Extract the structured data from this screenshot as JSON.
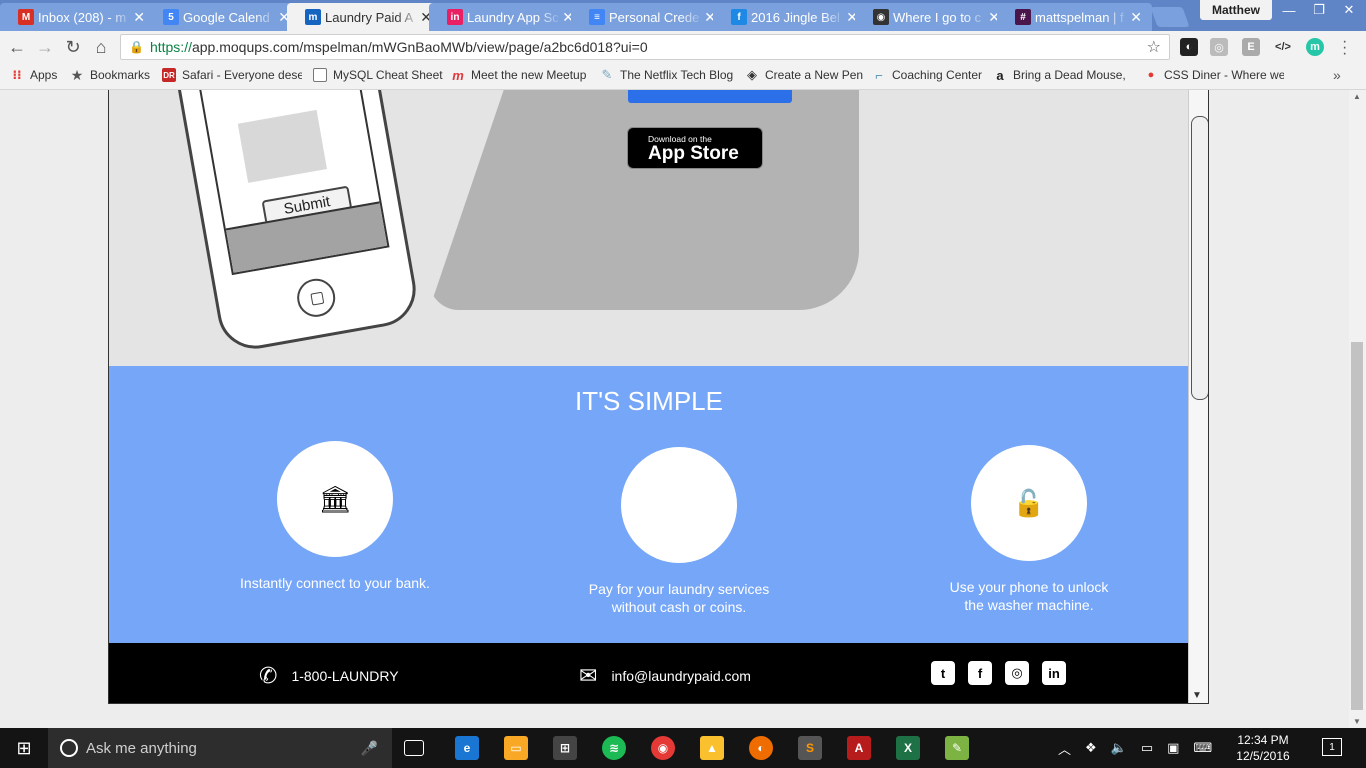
{
  "browser": {
    "tabs": [
      {
        "title": "Inbox (208) - m",
        "color": "#d93025",
        "glyph": "M"
      },
      {
        "title": "Google Calend",
        "color": "#4285f4",
        "glyph": "5"
      },
      {
        "title": "Laundry Paid A",
        "color": "#1565c0",
        "glyph": "m",
        "active": true
      },
      {
        "title": "Laundry App Sc",
        "color": "#e91e63",
        "glyph": "in"
      },
      {
        "title": "Personal Crede",
        "color": "#4285f4",
        "glyph": "≡"
      },
      {
        "title": "2016 Jingle Bel",
        "color": "#1e88e5",
        "glyph": "f"
      },
      {
        "title": "Where I go to c",
        "color": "#333333",
        "glyph": "◉"
      },
      {
        "title": "mattspelman | f",
        "color": "#4a154b",
        "glyph": "#"
      }
    ],
    "profile_name": "Matthew",
    "window_controls": {
      "minimize": "—",
      "restore": "❐",
      "close": "✕"
    },
    "url_scheme": "https://",
    "url_rest": "app.moqups.com/mspelman/mWGnBaoMWb/view/page/a2bc6d018?ui=0",
    "bookmarks": [
      {
        "label": "Apps",
        "icon": "apps-icon",
        "color": "#e53935",
        "glyph": "⋮⋮"
      },
      {
        "label": "Bookmarks",
        "icon": "star-icon",
        "color": "#555555",
        "glyph": "★"
      },
      {
        "label": "Safari - Everyone dese",
        "icon": "safari-icon",
        "color": "#c62828",
        "glyph": "DR"
      },
      {
        "label": "MySQL Cheat Sheet",
        "icon": "page-icon",
        "color": "#777777",
        "glyph": "▯"
      },
      {
        "label": "Meet the new Meetup",
        "icon": "meetup-icon",
        "color": "#e0393e",
        "glyph": "m"
      },
      {
        "label": "The Netflix Tech Blog",
        "icon": "pen-icon",
        "color": "#7aa6c2",
        "glyph": "✎"
      },
      {
        "label": "Create a New Pen",
        "icon": "codepen-icon",
        "color": "#333333",
        "glyph": "◈"
      },
      {
        "label": "Coaching Center",
        "icon": "coach-icon",
        "color": "#4a90b8",
        "glyph": "⌐"
      },
      {
        "label": "Bring a Dead Mouse,",
        "icon": "amazon-icon",
        "color": "#222222",
        "glyph": "a"
      },
      {
        "label": "CSS Diner - Where we",
        "icon": "diner-icon",
        "color": "#e53935",
        "glyph": "●"
      }
    ],
    "bookmarks_more": "»"
  },
  "page": {
    "phone_submit_label": "Submit",
    "appstore_small": "Download on the",
    "appstore_big": "App Store",
    "section_title": "IT'S SIMPLE",
    "features": [
      {
        "icon": "bank-icon",
        "glyph": "🏛",
        "text_line1": "Instantly connect to your bank.",
        "text_line2": ""
      },
      {
        "icon": "apple-icon",
        "glyph": "",
        "text_line1": "Pay for your laundry services",
        "text_line2": "without cash or coins."
      },
      {
        "icon": "unlock-icon",
        "glyph": "🔓",
        "text_line1": "Use your phone to unlock",
        "text_line2": "the washer machine."
      }
    ],
    "footer": {
      "phone": "1-800-LAUNDRY",
      "email": "info@laundrypaid.com",
      "social": [
        {
          "name": "twitter-icon",
          "glyph": "t"
        },
        {
          "name": "facebook-icon",
          "glyph": "f"
        },
        {
          "name": "instagram-icon",
          "glyph": "◎"
        },
        {
          "name": "linkedin-icon",
          "glyph": "in"
        }
      ]
    }
  },
  "taskbar": {
    "search_placeholder": "Ask me anything",
    "time": "12:34 PM",
    "date": "12/5/2016",
    "notification_count": "1"
  },
  "colors": {
    "section_blue": "#76a6f7",
    "cta_blue": "#2b70e8",
    "tab_bar": "#5f85c7"
  }
}
